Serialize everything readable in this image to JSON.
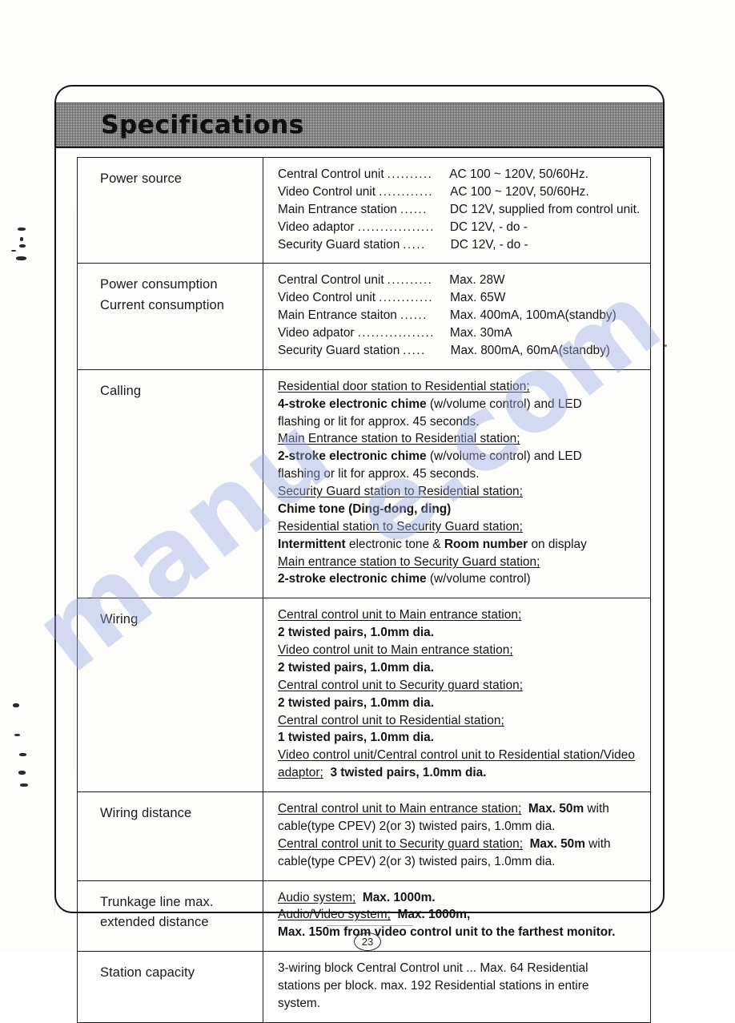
{
  "header": {
    "title": "Specifications"
  },
  "watermark": {
    "left_text": "manu",
    "right_text": "e.com"
  },
  "footer": {
    "page_number": "23"
  },
  "table": {
    "rows": [
      {
        "label": "Power source",
        "type": "leader",
        "entries": [
          {
            "name": "Central Control unit",
            "dots": "..........",
            "value": "AC 100 ~ 120V, 50/60Hz."
          },
          {
            "name": "Video Control unit",
            "dots": "............",
            "value": "AC 100 ~ 120V, 50/60Hz."
          },
          {
            "name": "Main Entrance station",
            "dots": "......",
            "value": "DC 12V, supplied from control unit."
          },
          {
            "name": "Video adaptor",
            "dots": ".................",
            "value": "DC 12V,   - do -"
          },
          {
            "name": "Security Guard station",
            "dots": ".....",
            "value": "DC 12V,   - do -"
          }
        ]
      },
      {
        "label": "Power consumption",
        "label2": "Current consumption",
        "type": "leader",
        "entries": [
          {
            "name": "Central Control unit",
            "dots": "..........",
            "value": "Max. 28W"
          },
          {
            "name": "Video Control unit",
            "dots": "............",
            "value": "Max. 65W"
          },
          {
            "name": "Main Entrance staiton",
            "dots": "......",
            "value": "Max. 400mA, 100mA(standby)"
          },
          {
            "name": "Video adpator",
            "dots": ".................",
            "value": "Max. 30mA"
          },
          {
            "name": "Security Guard station",
            "dots": ".....",
            "value": "Max. 800mA, 60mA(standby)"
          }
        ]
      },
      {
        "label": "Calling",
        "type": "blocks",
        "blocks": [
          {
            "head": "Residential door station to Residential station;",
            "bold": "4-stroke electronic chime",
            "rest": " (w/volume control) and LED",
            "extra": "flashing or lit for approx. 45 seconds."
          },
          {
            "head": "Main Entrance station to Residential station;",
            "bold": "2-stroke electronic chime",
            "rest": " (w/volume control) and LED",
            "extra": "flashing or lit for approx. 45 seconds."
          },
          {
            "head": "Security Guard station to Residential station;",
            "bold": "Chime tone (Ding-dong, ding)",
            "rest": "",
            "extra": ""
          },
          {
            "head": "Residential station to Security Guard station;",
            "bold": "Intermittent",
            "rest": " electronic tone & ",
            "bold2": "Room number",
            "rest2": " on display",
            "extra": ""
          },
          {
            "head": "Main entrance station to Security Guard station;",
            "bold": "2-stroke electronic chime",
            "rest": " (w/volume control)",
            "extra": ""
          }
        ]
      },
      {
        "label": "Wiring",
        "type": "blocks",
        "blocks": [
          {
            "head": "Central control unit to Main entrance station;",
            "bold": "2 twisted pairs, 1.0mm dia.",
            "rest": "",
            "extra": ""
          },
          {
            "head": "Video control unit to Main entrance station;",
            "bold": "2 twisted pairs, 1.0mm dia.",
            "rest": "",
            "extra": ""
          },
          {
            "head": "Central control unit to Security guard station;",
            "bold": "2 twisted pairs, 1.0mm dia.",
            "rest": "",
            "extra": ""
          },
          {
            "head": "Central control unit to Residential station;",
            "bold": "1 twisted pairs, 1.0mm dia.",
            "rest": "",
            "extra": ""
          },
          {
            "head": "Video control unit/Central control unit to Residential station/Video adaptor;",
            "bold": "3 twisted pairs, 1.0mm dia.",
            "rest": "",
            "extra": "",
            "inline": true
          }
        ]
      },
      {
        "label": "Wiring distance",
        "type": "blocks",
        "blocks": [
          {
            "head": "Central control unit to Main entrance station;",
            "bold": "Max. 50m",
            "rest": " with",
            "extra": "cable(type CPEV) 2(or 3) twisted pairs, 1.0mm dia.",
            "inline": true
          },
          {
            "head": "Central control unit to Security guard station;",
            "bold": "Max. 50m",
            "rest": " with",
            "extra": "cable(type CPEV) 2(or 3) twisted pairs, 1.0mm dia.",
            "inline": true
          }
        ]
      },
      {
        "label": "Trunkage line max.",
        "label2": "extended distance",
        "type": "blocks",
        "blocks": [
          {
            "head": "Audio system;",
            "bold": "Max. 1000m.",
            "rest": "",
            "extra": "",
            "inline": true
          },
          {
            "head": "Audio/Video system;",
            "bold": "Max. 1000m,",
            "rest": "",
            "extra": "",
            "inline": true,
            "boldline": "Max. 150m from video control unit to the farthest monitor."
          }
        ]
      },
      {
        "label": "Station capacity",
        "type": "plain",
        "lines": [
          "3-wiring block Central Control unit ... Max. 64 Residential",
          "stations per block.  max. 192 Residential stations in entire",
          "system."
        ]
      }
    ]
  }
}
